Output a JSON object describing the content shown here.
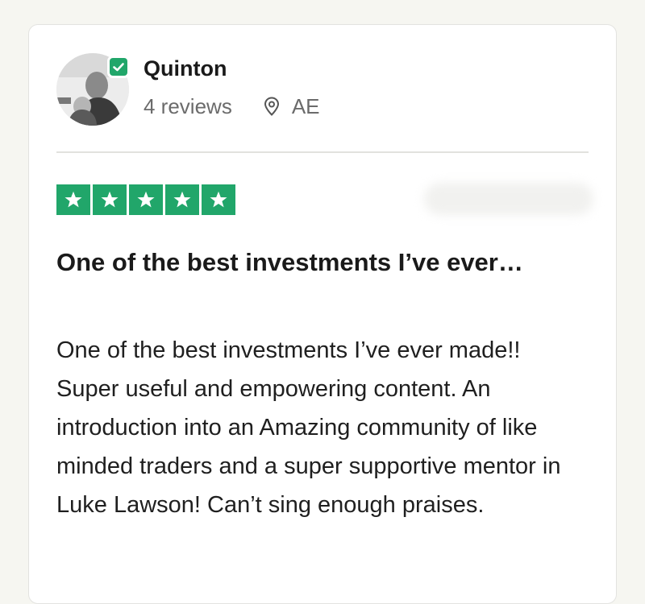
{
  "review": {
    "reviewer": {
      "name": "Quinton",
      "reviews_count": "4 reviews",
      "country": "AE",
      "verified_icon": "check-badge-icon",
      "location_icon": "map-pin-icon"
    },
    "rating": {
      "stars": 5,
      "max": 5,
      "color": "#21a66a"
    },
    "title": "One of the best investments I’ve ever…",
    "body": "One of the best investments I’ve ever made!! Super useful and empowering content. An introduction into an Amazing community of like minded traders and a super supportive mentor in Luke Lawson! Can’t sing enough praises."
  }
}
